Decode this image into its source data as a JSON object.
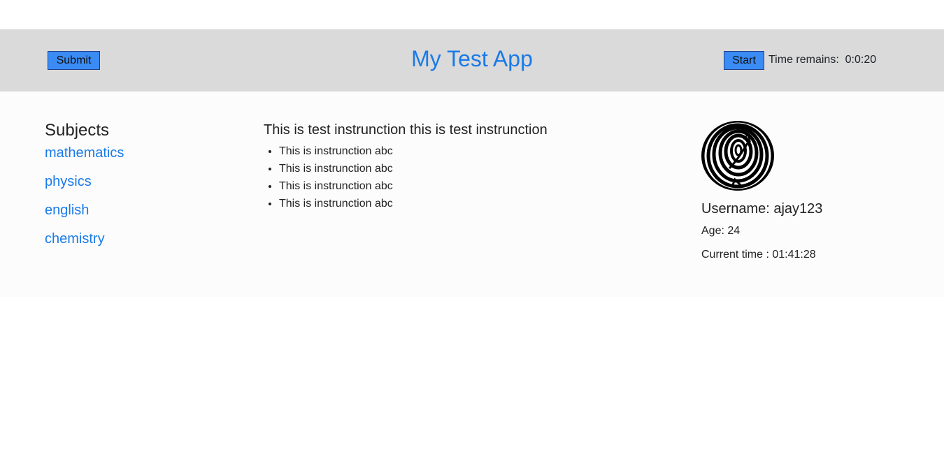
{
  "header": {
    "submit_label": "Submit",
    "title": "My Test App",
    "start_label": "Start",
    "timer_label": "Time remains:",
    "timer_value": "0:0:20"
  },
  "subjects": {
    "title": "Subjects",
    "items": [
      "mathematics",
      "physics",
      "english",
      "chemistry"
    ]
  },
  "instructions": {
    "title": "This is test instrunction this is test instrunction",
    "items": [
      "This is instrunction abc",
      "This is instrunction abc",
      "This is instrunction abc",
      "This is instrunction abc"
    ]
  },
  "profile": {
    "avatar_icon": "fingerprint-spiral-avatar",
    "username": "Username: ajay123",
    "age": "Age: 24",
    "current_time": "Current time : 01:41:28"
  },
  "colors": {
    "header_bg": "#dadada",
    "accent": "#1a7ae8",
    "button": "#3a8bf4"
  }
}
